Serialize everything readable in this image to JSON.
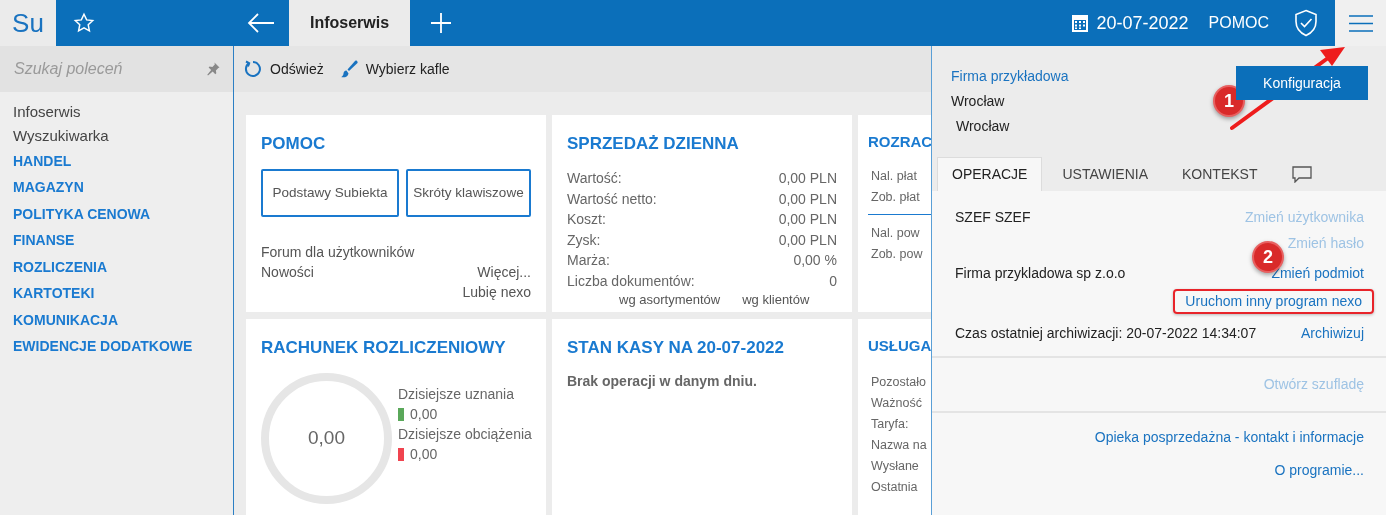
{
  "app_logo": "Su",
  "tabs": [
    {
      "label": "Infoserwis",
      "selected": true
    }
  ],
  "top_bar": {
    "date": "20-07-2022",
    "help": "POMOC"
  },
  "sidebar": {
    "search_placeholder": "Szukaj poleceń",
    "items": [
      {
        "label": "Infoserwis",
        "kind": "link"
      },
      {
        "label": "Wyszukiwarka",
        "kind": "link"
      },
      {
        "label": "HANDEL",
        "kind": "module"
      },
      {
        "label": "MAGAZYN",
        "kind": "module"
      },
      {
        "label": "POLITYKA CENOWA",
        "kind": "module"
      },
      {
        "label": "FINANSE",
        "kind": "module"
      },
      {
        "label": "ROZLICZENIA",
        "kind": "module"
      },
      {
        "label": "KARTOTEKI",
        "kind": "module"
      },
      {
        "label": "KOMUNIKACJA",
        "kind": "module"
      },
      {
        "label": "EWIDENCJE DODATKOWE",
        "kind": "module"
      }
    ]
  },
  "toolbar": [
    {
      "label": "Odśwież",
      "kind": "refresh"
    },
    {
      "label": "Wybierz kafle",
      "kind": "brush"
    }
  ],
  "tiles": [
    {
      "kind": "help",
      "title": "POMOC",
      "buttons": [
        "Podstawy Subiekta",
        "Skróty klawiszowe"
      ],
      "links": [
        {
          "left": "Forum dla użytkowników"
        },
        {
          "left": "Nowości",
          "right": "Więcej..."
        },
        {
          "right": "Lubię nexo"
        }
      ]
    },
    {
      "kind": "sales",
      "title": "SPRZEDAŻ DZIENNA",
      "rows": [
        [
          "Wartość:",
          "0,00 PLN"
        ],
        [
          "Wartość netto:",
          "0,00 PLN"
        ],
        [
          "Koszt:",
          "0,00 PLN"
        ],
        [
          "Zysk:",
          "0,00 PLN"
        ],
        [
          "Marża:",
          "0,00 %"
        ],
        [
          "Liczba dokumentów:",
          "0"
        ]
      ],
      "footer": [
        "wg asortymentów",
        "wg klientów"
      ]
    },
    {
      "kind": "partial",
      "title": "ROZRAC",
      "groups": [
        [
          "Nal. płat",
          "Zob. płat"
        ],
        [
          "Nal. pow",
          "Zob. pow"
        ]
      ]
    },
    {
      "kind": "account",
      "title": "RACHUNEK ROZLICZENIOWY",
      "total": "0,00",
      "legend": [
        {
          "label": "Dzisiejsze uznania",
          "value": "0,00",
          "color": "#5aa85a"
        },
        {
          "label": "Dzisiejsze obciążenia",
          "value": "0,00",
          "color": "#f0444f"
        }
      ]
    },
    {
      "kind": "cash",
      "title": "STAN KASY NA 20-07-2022",
      "message": "Brak operacji w danym dniu."
    },
    {
      "kind": "partial",
      "title": "USŁUGA",
      "groups": [
        [
          "Pozostało",
          "Ważność",
          "Taryfa:",
          "Nazwa na",
          "Wysłane",
          "Ostatnia"
        ]
      ]
    }
  ],
  "panel": {
    "company_link": "Firma przykładowa",
    "address": [
      "Wrocław",
      "Wrocław"
    ],
    "config_button": "Konfiguracja",
    "tabs": [
      {
        "kind": "text",
        "label": "OPERACJE",
        "selected": true
      },
      {
        "kind": "text",
        "label": "USTAWIENIA",
        "selected": false
      },
      {
        "kind": "text",
        "label": "KONTEKST",
        "selected": false
      },
      {
        "kind": "comment",
        "selected": false
      }
    ],
    "sections": [
      [
        {
          "text": "SZEF SZEF",
          "links": [
            {
              "label": "Zmień użytkownika",
              "disabled": true,
              "highlighted": false
            },
            {
              "label": "Zmień hasło",
              "disabled": true,
              "highlighted": false
            }
          ]
        },
        {
          "text": "Firma przykladowa sp z.o.o",
          "links": [
            {
              "label": "Zmień podmiot",
              "disabled": false,
              "highlighted": false
            },
            {
              "label": "Uruchom inny program nexo",
              "disabled": false,
              "highlighted": true
            }
          ]
        },
        {
          "text": "Czas ostatniej archiwizacji: 20-07-2022 14:34:07",
          "links": [
            {
              "label": "Archiwizuj",
              "disabled": false,
              "highlighted": false
            }
          ]
        }
      ],
      [
        {
          "links": [
            {
              "label": "Otwórz szufladę",
              "disabled": true,
              "highlighted": false
            }
          ]
        }
      ],
      [
        {
          "links": [
            {
              "label": "Opieka posprzedażna - kontakt i informacje",
              "disabled": false,
              "highlighted": false
            }
          ]
        },
        {
          "links": [
            {
              "label": "O programie...",
              "disabled": false,
              "highlighted": false
            }
          ]
        }
      ]
    ]
  },
  "annotations": [
    {
      "kind": "badge",
      "label": "1"
    },
    {
      "kind": "arrow"
    },
    {
      "kind": "badge",
      "label": "2"
    }
  ]
}
